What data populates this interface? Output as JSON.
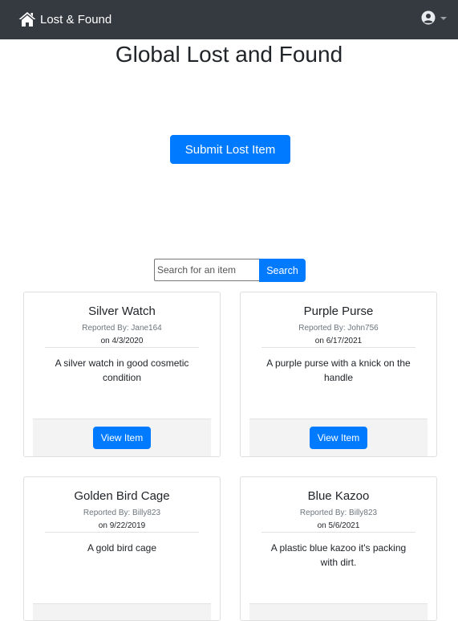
{
  "navbar": {
    "brand_label": "Lost & Found",
    "icons": {
      "home": "home-icon",
      "user": "user-circle-icon"
    }
  },
  "page": {
    "title": "Global Lost and Found",
    "submit_label": "Submit Lost Item"
  },
  "search": {
    "placeholder": "Search for an item",
    "button_label": "Search"
  },
  "colors": {
    "navbar": "#343a40",
    "primary": "#007bff"
  },
  "items": [
    {
      "title": "Silver Watch",
      "reported_by": "Reported By: Jane164",
      "date": "on 4/3/2020",
      "description": "A silver watch in good cosmetic condition",
      "button_label": "View Item"
    },
    {
      "title": "Purple Purse",
      "reported_by": "Reported By: John756",
      "date": "on 6/17/2021",
      "description": "A purple purse with a knick on the handle",
      "button_label": "View Item"
    },
    {
      "title": "Golden Bird Cage",
      "reported_by": "Reported By: Billy823",
      "date": "on 9/22/2019",
      "description": "A gold bird cage"
    },
    {
      "title": "Blue Kazoo",
      "reported_by": "Reported By: Billy823",
      "date": "on 5/6/2021",
      "description": "A plastic blue kazoo it's packing with dirt."
    }
  ]
}
